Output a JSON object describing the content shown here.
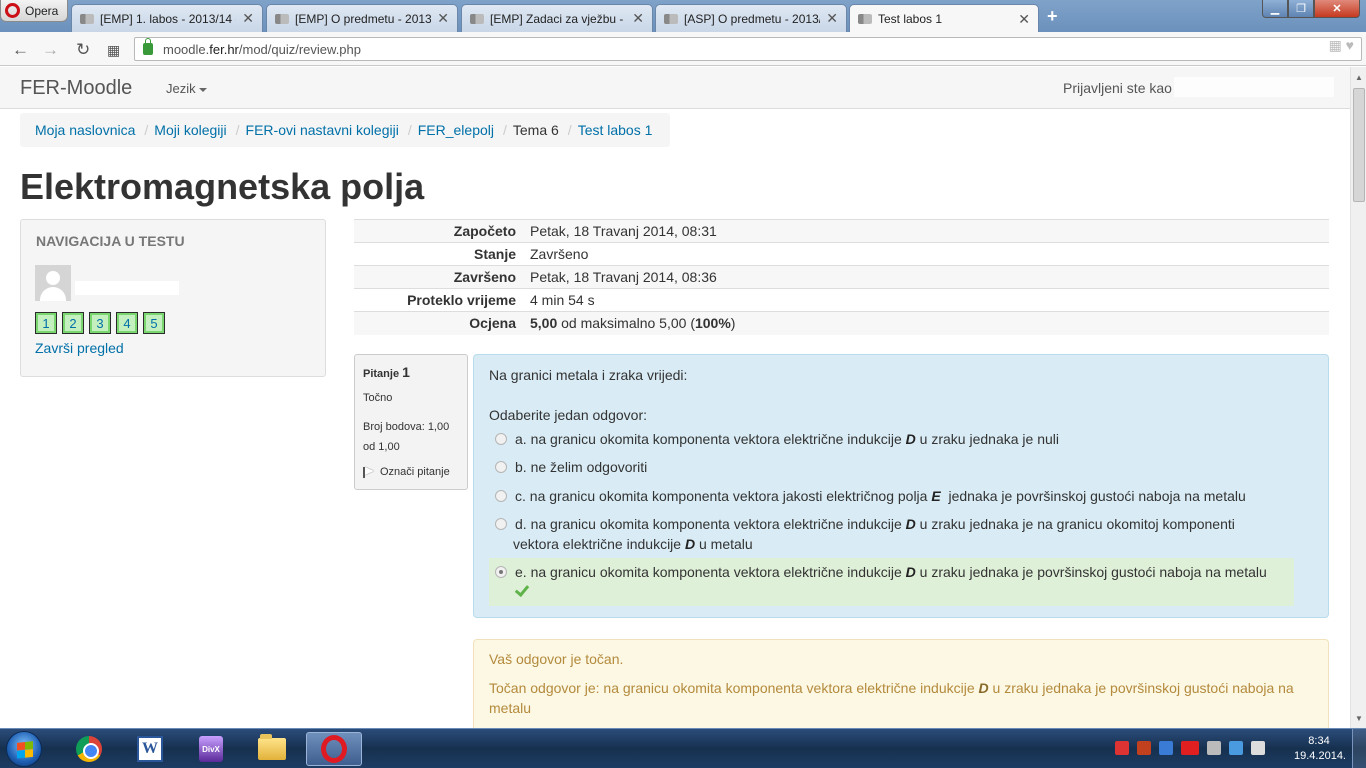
{
  "browser": {
    "menu_label": "Opera",
    "tabs": [
      {
        "title": "[EMP] 1. labos - 2013/14 - ..."
      },
      {
        "title": "[EMP] O predmetu - 2013/..."
      },
      {
        "title": "[EMP] Zadaci za vježbu - 1..."
      },
      {
        "title": "[ASP] O predmetu - 2013/..."
      },
      {
        "title": "Test labos 1"
      }
    ],
    "url_prefix": "moodle.",
    "url_domain": "fer.hr",
    "url_path": "/mod/quiz/review.php"
  },
  "navbar": {
    "brand": "FER-Moodle",
    "language": "Jezik",
    "logged_in": "Prijavljeni ste kao"
  },
  "breadcrumb": [
    {
      "label": "Moja naslovnica"
    },
    {
      "label": "Moji kolegiji"
    },
    {
      "label": "FER-ovi nastavni kolegiji"
    },
    {
      "label": "FER_elepolj"
    },
    {
      "label": "Tema 6"
    },
    {
      "label": "Test labos 1"
    }
  ],
  "page_title": "Elektromagnetska polja",
  "quiz_nav": {
    "heading": "Navigacija u testu",
    "questions": [
      "1",
      "2",
      "3",
      "4",
      "5"
    ],
    "finish_review": "Završi pregled"
  },
  "summary": [
    {
      "label": "Započeto",
      "value": "Petak, 18 Travanj 2014, 08:31"
    },
    {
      "label": "Stanje",
      "value": "Završeno"
    },
    {
      "label": "Završeno",
      "value": "Petak, 18 Travanj 2014, 08:36"
    },
    {
      "label": "Proteklo vrijeme",
      "value": "4 min 54 s"
    },
    {
      "label": "Ocjena",
      "value_bold": "5,00",
      "value_mid": " od maksimalno 5,00 (",
      "value_pct": "100%",
      "value_end": ")"
    }
  ],
  "question": {
    "label": "Pitanje",
    "number": "1",
    "state": "Točno",
    "grade": "Broj bodova: 1,00 od 1,00",
    "flag": "Označi pitanje",
    "text": "Na granici metala i zraka vrijedi:",
    "prompt": "Odaberite jedan odgovor:",
    "answers": [
      {
        "pre": "a. na granicu okomita komponenta vektora električne indukcije ",
        "var": "D",
        "post": " u zraku jednaka je nuli"
      },
      {
        "pre": "b. ne želim odgovoriti"
      },
      {
        "pre": "c. na granicu okomita komponenta vektora jakosti električnog polja ",
        "var": "E",
        "post": "  jednaka je površinskoj gustoći naboja na metalu"
      },
      {
        "pre": "d. na granicu okomita komponenta vektora električne indukcije ",
        "var": "D",
        "post": " u zraku jednaka je na granicu okomitoj komponenti",
        "line2_pre": "vektora električne indukcije ",
        "line2_var": "D",
        "line2_post": " u metalu"
      },
      {
        "pre": "e. na granicu okomita komponenta vektora električne indukcije ",
        "var": "D",
        "post": " u zraku jednaka je površinskoj gustoći naboja na metalu"
      }
    ],
    "feedback_correct": "Vaš odgovor je točan.",
    "right_answer_pre": "Točan odgovor je: na granicu okomita komponenta vektora električne indukcije ",
    "right_answer_var": "D",
    "right_answer_post": " u zraku jednaka je površinskoj gustoći naboja na metalu"
  },
  "taskbar": {
    "time": "8:34",
    "date": "19.4.2014.",
    "divx_label": "DivX"
  },
  "colors": {
    "link": "#0070a8",
    "question_bg": "#d9ecf5",
    "correct_bg": "#dff0d8",
    "feedback_bg": "#fcf8e3"
  }
}
